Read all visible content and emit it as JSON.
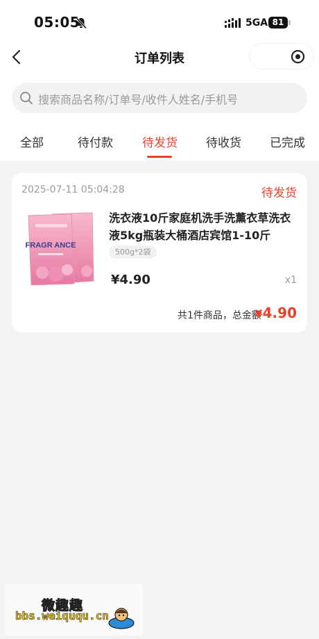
{
  "status_bar": {
    "time": "05:05",
    "network": "5GA",
    "battery": "81"
  },
  "nav": {
    "title": "订单列表"
  },
  "search": {
    "placeholder": "搜索商品名称/订单号/收件人姓名/手机号"
  },
  "tabs": [
    {
      "label": "全部",
      "active": false
    },
    {
      "label": "待付款",
      "active": false
    },
    {
      "label": "待发货",
      "active": true
    },
    {
      "label": "待收货",
      "active": false
    },
    {
      "label": "已完成",
      "active": false
    }
  ],
  "order": {
    "time": "2025-07-11 05:04:28",
    "status": "待发货",
    "product": {
      "title": "洗衣液10斤家庭机洗手洗薰衣草洗衣液5kg瓶装大桶酒店宾馆1-10斤",
      "spec": "500g*2袋",
      "price": "¥4.90",
      "quantity": "x1",
      "image_text": "FRAGR ANCE"
    },
    "summary": {
      "label": "共1件商品，总金额",
      "currency": "¥",
      "amount": "4.90"
    }
  },
  "watermark": {
    "name": "微趣趣",
    "url": "bbs.weiququ.cn"
  },
  "colors": {
    "accent": "#e8412b",
    "background": "#f3f3f3",
    "card": "#ffffff"
  }
}
